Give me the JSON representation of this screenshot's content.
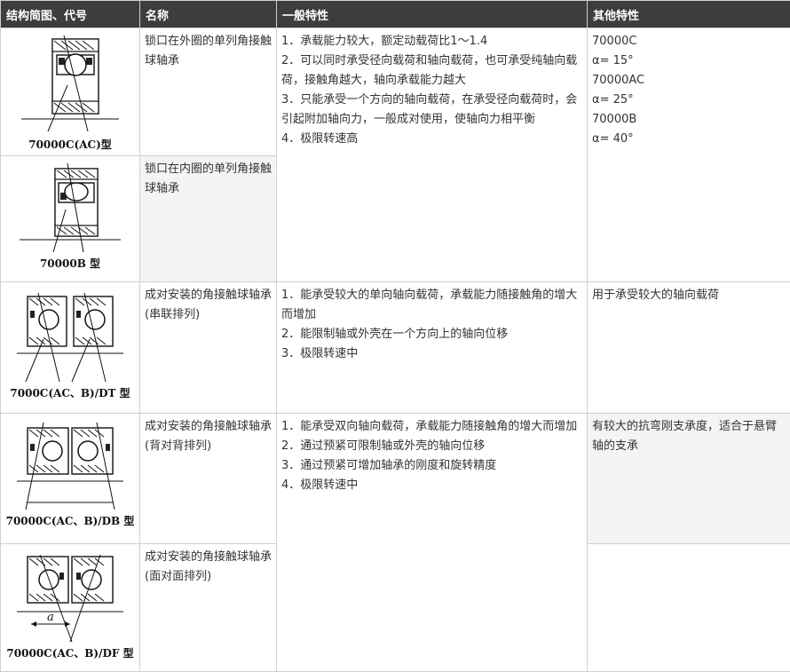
{
  "headers": {
    "structure": "结构简图、代号",
    "name": "名称",
    "general": "一般特性",
    "other": "其他特性"
  },
  "rows": {
    "r1": {
      "code": "70000C(AC)型",
      "name": "锁口在外圈的单列角接触球轴承"
    },
    "r2": {
      "code": "70000B 型",
      "name": "锁口在内圈的单列角接触球轴承"
    },
    "r3": {
      "code": "7000C(AC、B)/DT 型",
      "name": "成对安装的角接触球轴承(串联排列)"
    },
    "r4": {
      "code": "70000C(AC、B)/DB 型",
      "name": "成对安装的角接触球轴承(背对背排列)"
    },
    "r5": {
      "code": "70000C(AC、B)/DF 型",
      "name": "成对安装的角接触球轴承(面对面排列)",
      "dim_label": "a"
    }
  },
  "general": {
    "g1": [
      "1．承载能力较大，额定动载荷比1～1.4",
      "2．可以同时承受径向载荷和轴向载荷，也可承受纯轴向载荷，接触角越大，轴向承载能力越大",
      "3．只能承受一个方向的轴向载荷，在承受径向载荷时，会引起附加轴向力，一般成对使用，使轴向力相平衡",
      "4．极限转速高"
    ],
    "g3": [
      "1．能承受较大的单向轴向载荷，承载能力随接触角的增大而增加",
      "2．能限制轴或外壳在一个方向上的轴向位移",
      "3．极限转速中"
    ],
    "g4": [
      "1．能承受双向轴向载荷，承载能力随接触角的增大而增加",
      "2．通过预紧可限制轴或外壳的轴向位移",
      "3．通过预紧可增加轴承的刚度和旋转精度",
      "4．极限转速中"
    ]
  },
  "other": {
    "o1": [
      "70000C",
      "α= 15°",
      "70000AC",
      "α= 25°",
      "70000B",
      "α= 40°"
    ],
    "o3": "用于承受较大的轴向载荷",
    "o4": "有较大的抗弯刚支承度，适合于悬臂轴的支承"
  }
}
